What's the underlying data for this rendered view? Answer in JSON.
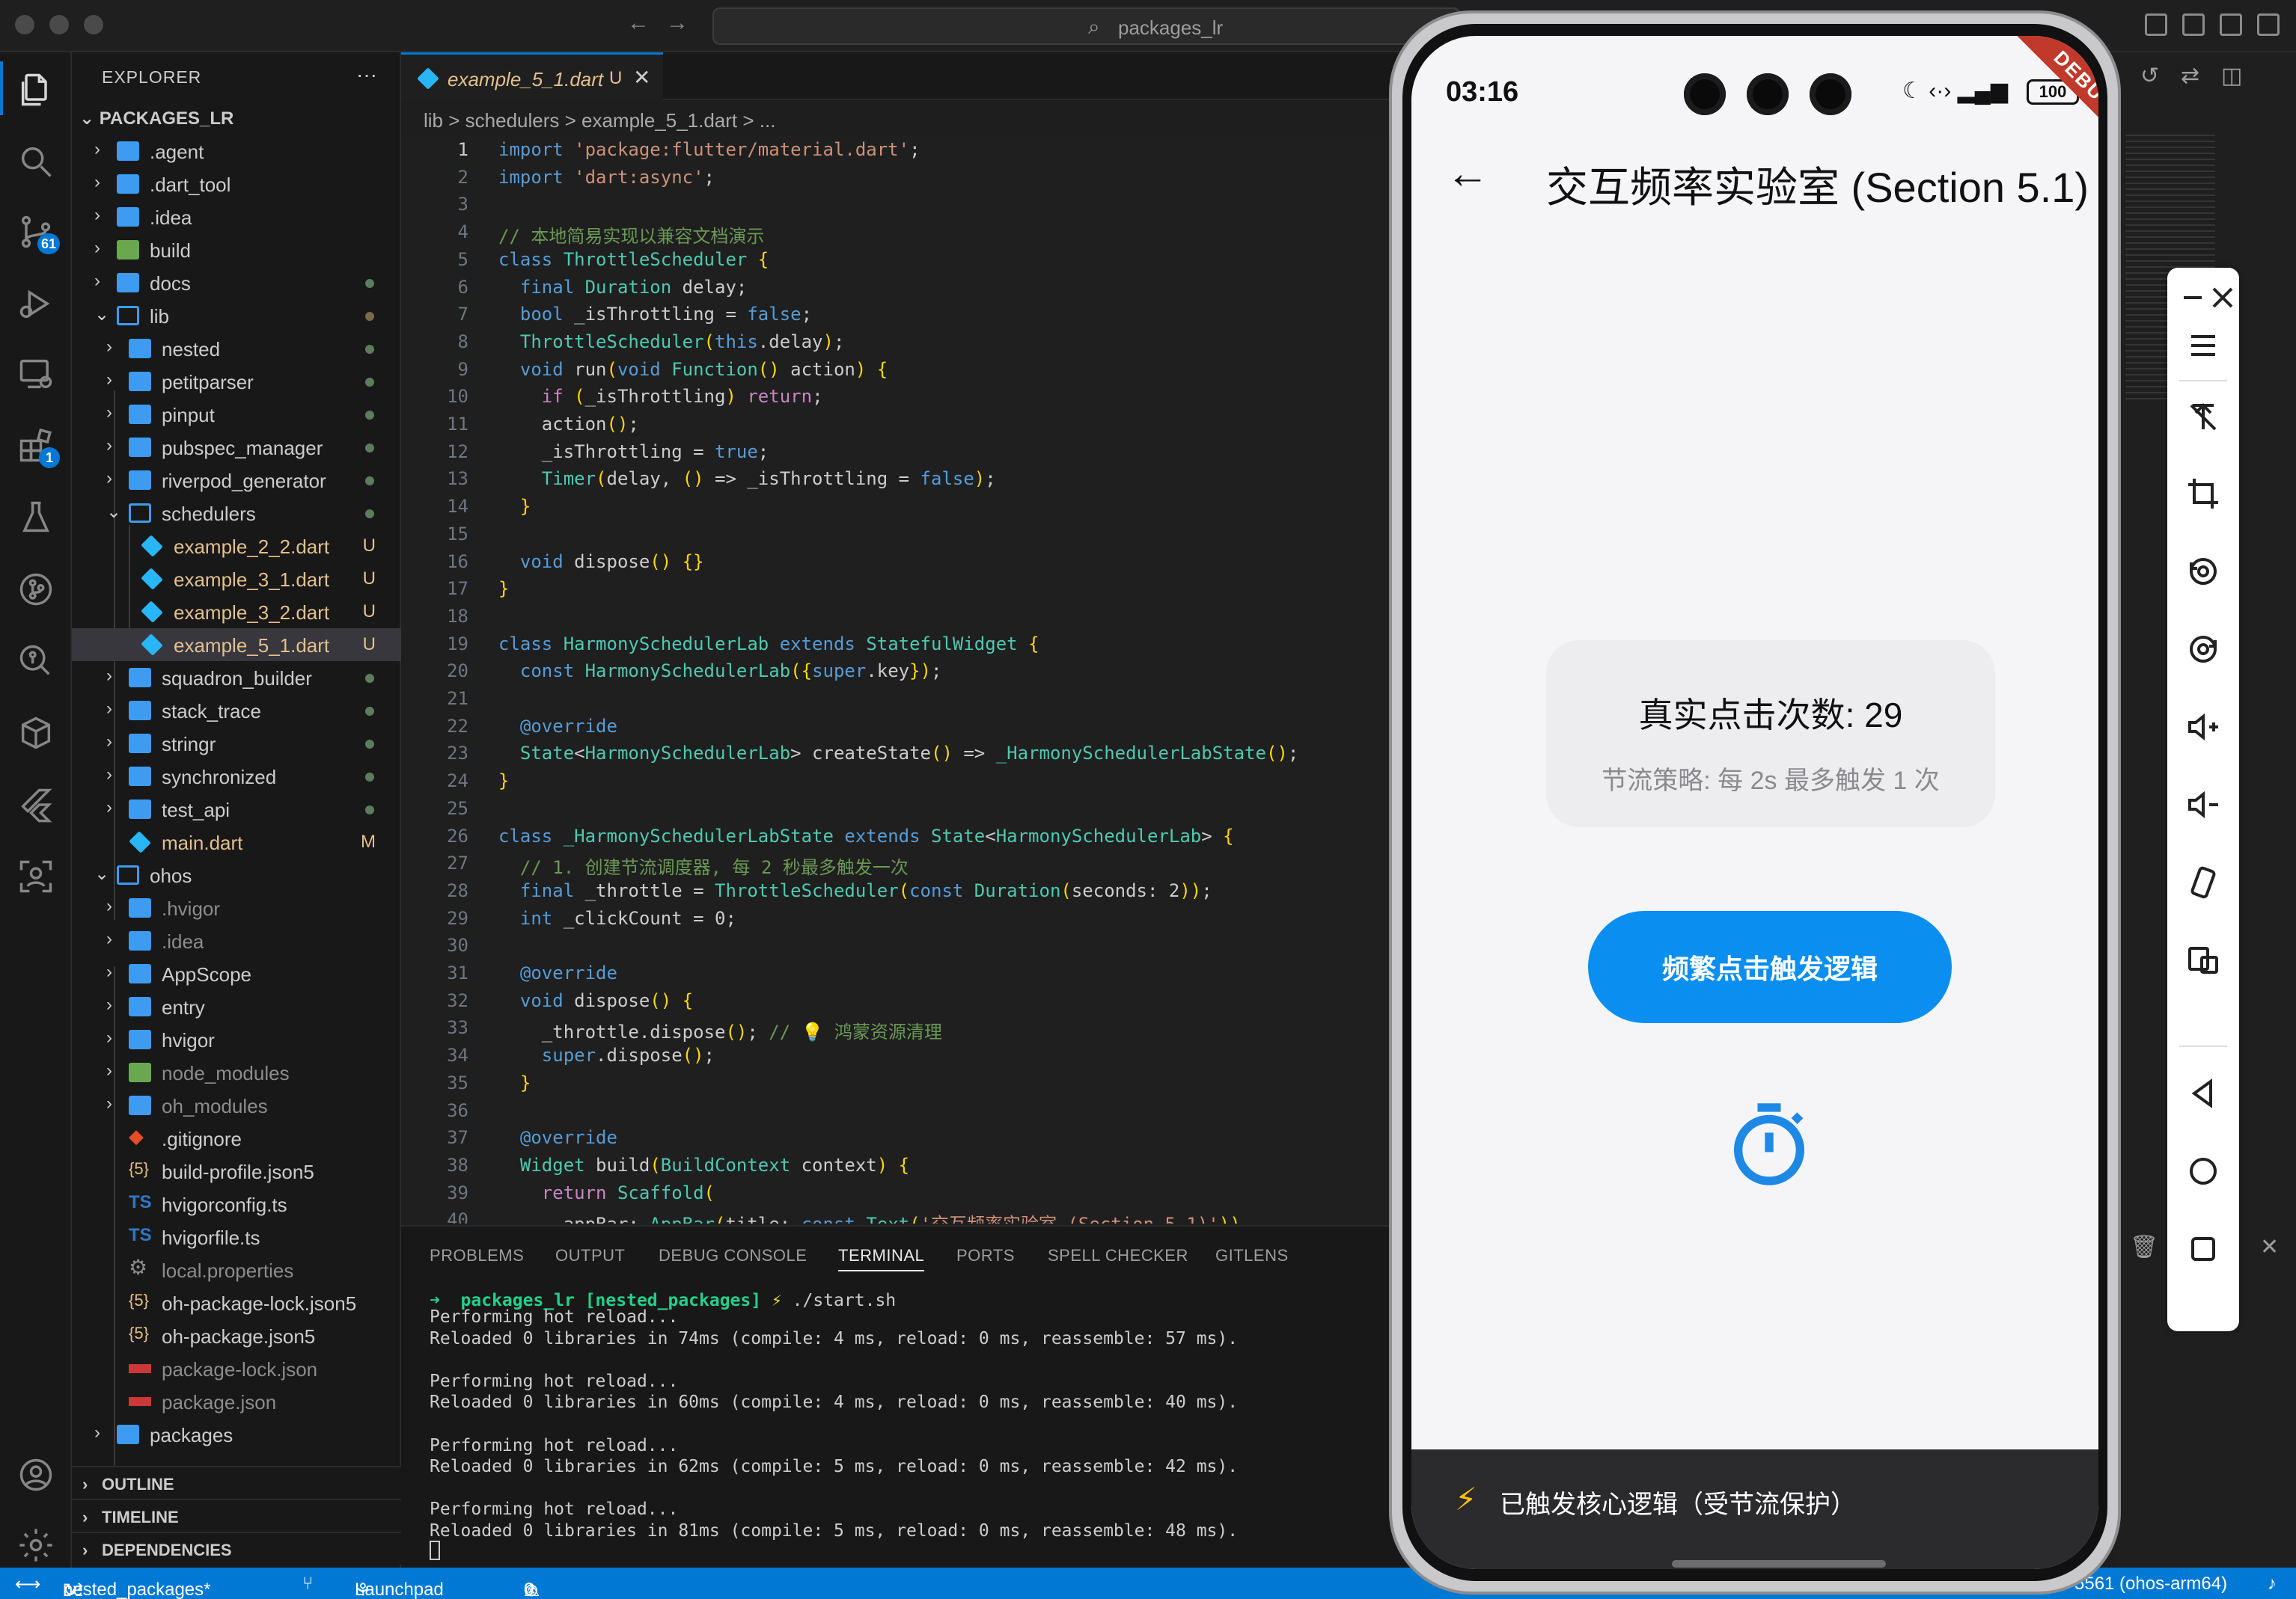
{
  "window": {
    "search_text": "packages_lr"
  },
  "activity": {
    "scm_badge": "61",
    "ext_badge": "1"
  },
  "explorer": {
    "title": "EXPLORER",
    "more": "···",
    "root": "PACKAGES_LR",
    "items": [
      {
        "name": ".agent",
        "status": ""
      },
      {
        "name": ".dart_tool",
        "status": ""
      },
      {
        "name": ".idea",
        "status": ""
      },
      {
        "name": "build",
        "status": ""
      },
      {
        "name": "docs",
        "status": ""
      },
      {
        "name": "lib",
        "status": ""
      },
      {
        "name": "nested",
        "status": ""
      },
      {
        "name": "petitparser",
        "status": ""
      },
      {
        "name": "pinput",
        "status": ""
      },
      {
        "name": "pubspec_manager",
        "status": ""
      },
      {
        "name": "riverpod_generator",
        "status": ""
      },
      {
        "name": "schedulers",
        "status": ""
      },
      {
        "name": "example_2_2.dart",
        "status": "U"
      },
      {
        "name": "example_3_1.dart",
        "status": "U"
      },
      {
        "name": "example_3_2.dart",
        "status": "U"
      },
      {
        "name": "example_5_1.dart",
        "status": "U"
      },
      {
        "name": "squadron_builder",
        "status": ""
      },
      {
        "name": "stack_trace",
        "status": ""
      },
      {
        "name": "stringr",
        "status": ""
      },
      {
        "name": "synchronized",
        "status": ""
      },
      {
        "name": "test_api",
        "status": ""
      },
      {
        "name": "main.dart",
        "status": "M"
      },
      {
        "name": "ohos",
        "status": ""
      },
      {
        "name": ".hvigor",
        "status": ""
      },
      {
        "name": ".idea",
        "status": ""
      },
      {
        "name": "AppScope",
        "status": ""
      },
      {
        "name": "entry",
        "status": ""
      },
      {
        "name": "hvigor",
        "status": ""
      },
      {
        "name": "node_modules",
        "status": ""
      },
      {
        "name": "oh_modules",
        "status": ""
      },
      {
        "name": ".gitignore",
        "status": ""
      },
      {
        "name": "build-profile.json5",
        "status": ""
      },
      {
        "name": "hvigorconfig.ts",
        "status": ""
      },
      {
        "name": "hvigorfile.ts",
        "status": ""
      },
      {
        "name": "local.properties",
        "status": ""
      },
      {
        "name": "oh-package-lock.json5",
        "status": ""
      },
      {
        "name": "oh-package.json5",
        "status": ""
      },
      {
        "name": "package-lock.json",
        "status": ""
      },
      {
        "name": "package.json",
        "status": ""
      },
      {
        "name": "packages",
        "status": ""
      }
    ],
    "sections": [
      "OUTLINE",
      "TIMELINE",
      "DEPENDENCIES"
    ]
  },
  "editor": {
    "tab_label": "example_5_1.dart",
    "tab_status": "U",
    "breadcrumb": "lib  >  schedulers  >     example_5_1.dart  >  ..."
  },
  "code_lines": [
    "import 'package:flutter/material.dart';",
    "import 'dart:async';",
    "",
    "// 本地简易实现以兼容文档演示",
    "class ThrottleScheduler {",
    "  final Duration delay;",
    "  bool _isThrottling = false;",
    "  ThrottleScheduler(this.delay);",
    "  void run(void Function() action) {",
    "    if (_isThrottling) return;",
    "    action();",
    "    _isThrottling = true;",
    "    Timer(delay, () => _isThrottling = false);",
    "  }",
    "",
    "  void dispose() {}",
    "}",
    "",
    "class HarmonySchedulerLab extends StatefulWidget {",
    "  const HarmonySchedulerLab({super.key});",
    "",
    "  @override",
    "  State<HarmonySchedulerLab> createState() => _HarmonySchedulerLabState();",
    "}",
    "",
    "class _HarmonySchedulerLabState extends State<HarmonySchedulerLab> {",
    "  // 1. 创建节流调度器, 每 2 秒最多触发一次",
    "  final _throttle = ThrottleScheduler(const Duration(seconds: 2));",
    "  int _clickCount = 0;",
    "",
    "  @override",
    "  void dispose() {",
    "    _throttle.dispose(); // 💡 鸿蒙资源清理",
    "    super.dispose();",
    "  }",
    "",
    "  @override",
    "  Widget build(BuildContext context) {",
    "    return Scaffold(",
    "      appBar: AppBar(title: const Text('交互频率实验室 (Section 5.1)')),"
  ],
  "panel": {
    "tabs": [
      "PROBLEMS",
      "OUTPUT",
      "DEBUG CONSOLE",
      "TERMINAL",
      "PORTS",
      "SPELL CHECKER",
      "GITLENS"
    ],
    "active_tab": "TERMINAL",
    "prompt": "packages_lr [nested_packages]",
    "command": "./start.sh",
    "lines": [
      "Performing hot reload...",
      "Reloaded 0 libraries in 74ms (compile: 4 ms, reload: 0 ms, reassemble: 57 ms).",
      "",
      "Performing hot reload...",
      "Reloaded 0 libraries in 60ms (compile: 4 ms, reload: 0 ms, reassemble: 40 ms).",
      "",
      "Performing hot reload...",
      "Reloaded 0 libraries in 62ms (compile: 5 ms, reload: 0 ms, reassemble: 42 ms).",
      "",
      "Performing hot reload...",
      "Reloaded 0 libraries in 81ms (compile: 5 ms, reload: 0 ms, reassemble: 48 ms)."
    ]
  },
  "statusbar": {
    "branch": "nested_packages*",
    "launchpad": "Launchpad",
    "errors": "0",
    "warnings": "0",
    "device": "5561 (ohos-arm64)"
  },
  "phone": {
    "time": "03:16",
    "battery": "100",
    "debug_label": "DEBUG",
    "app_title": "交互频率实验室 (Section 5.1)",
    "click_count_text": "真实点击次数: 29",
    "policy_text": "节流策略: 每 2s 最多触发 1 次",
    "button_label": "频繁点击触发逻辑",
    "snackbar_text": "已触发核心逻辑（受节流保护）"
  },
  "colors": {
    "accent": "#0078d4",
    "button": "#0a8eef",
    "snackbar": "#2b2b2e",
    "untracked": "#e2c08d"
  }
}
